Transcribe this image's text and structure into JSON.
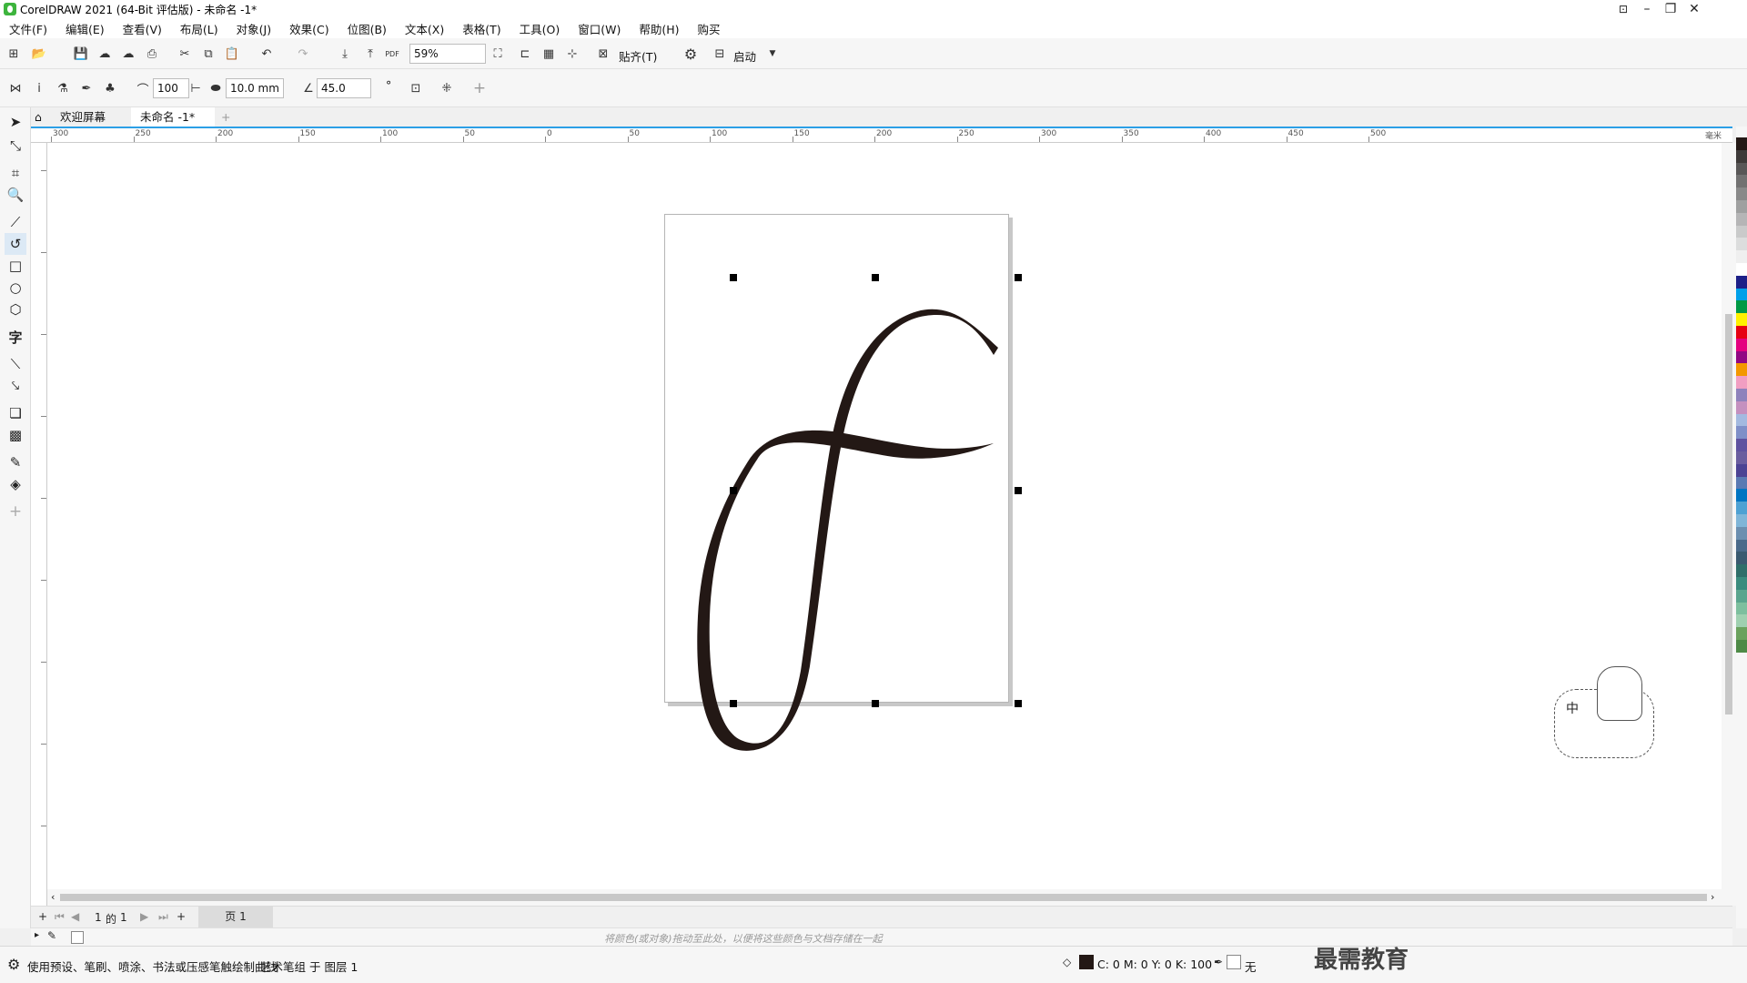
{
  "window": {
    "title": "CorelDRAW 2021 (64-Bit 评估版) - 未命名 -1*",
    "minimize_icon": "minimize-icon",
    "restore_icon": "restore-icon",
    "close_icon": "close-icon"
  },
  "menu": [
    "文件(F)",
    "编辑(E)",
    "查看(V)",
    "布局(L)",
    "对象(J)",
    "效果(C)",
    "位图(B)",
    "文本(X)",
    "表格(T)",
    "工具(O)",
    "窗口(W)",
    "帮助(H)",
    "购买"
  ],
  "standard_toolbar": {
    "zoom_value": "59%",
    "snap_label": "贴齐(T)",
    "launch_label": "启动"
  },
  "property_bar": {
    "smoothing_value": "100",
    "width_value": "10.0 mm",
    "angle_value": "45.0",
    "angle_unit": "°"
  },
  "tabs": {
    "welcome": "欢迎屏幕",
    "document": "未命名 -1*",
    "add_tab": "+"
  },
  "ruler": {
    "h_labels": [
      "300",
      "250",
      "200",
      "150",
      "100",
      "50",
      "0",
      "50",
      "100",
      "150",
      "200",
      "250",
      "300",
      "350",
      "400",
      "450",
      "500"
    ],
    "unit": "毫米"
  },
  "page_nav": {
    "current": "1",
    "of_label": "的",
    "total": "1",
    "page_tab": "页 1"
  },
  "color_bar": {
    "hint": "将颜色(或对象)拖动至此处，以便将这些颜色与文档存储在一起"
  },
  "status": {
    "tool_hint": "使用预设、笔刷、喷涂、书法或压感笔触绘制曲线",
    "selection_info": "艺术笔组 于 图层 1",
    "fill_values": "C: 0 M: 0 Y: 0 K: 100",
    "outline_value": "无"
  },
  "ime": {
    "mode": "中"
  },
  "watermark": "最需教育",
  "colors": {
    "accent": "#2b9fe6",
    "stroke_fill": "#231815",
    "app_green": "#3db43d"
  },
  "palette": [
    "#231815",
    "#3e3a39",
    "#595757",
    "#727171",
    "#898989",
    "#9fa0a0",
    "#b5b5b6",
    "#c9caca",
    "#dcdddd",
    "#efefef",
    "#ffffff",
    "#1d2088",
    "#00a0e9",
    "#009944",
    "#fff100",
    "#e60012",
    "#e4007f",
    "#920783",
    "#f39800",
    "#f19ec2",
    "#8f82bc",
    "#c490bf",
    "#a3b9e0",
    "#7f8fc8",
    "#5f52a0",
    "#6a5d9f",
    "#4c4394",
    "#5a7ab3",
    "#0075c2",
    "#4ea1d3",
    "#7fb5d8",
    "#6c8fb0",
    "#4a6a8a",
    "#3a5a70",
    "#2f6f6a",
    "#3a8c7e",
    "#5aa58e",
    "#7dbf9e",
    "#9fd0b0",
    "#6ba25e",
    "#4e8a47"
  ]
}
